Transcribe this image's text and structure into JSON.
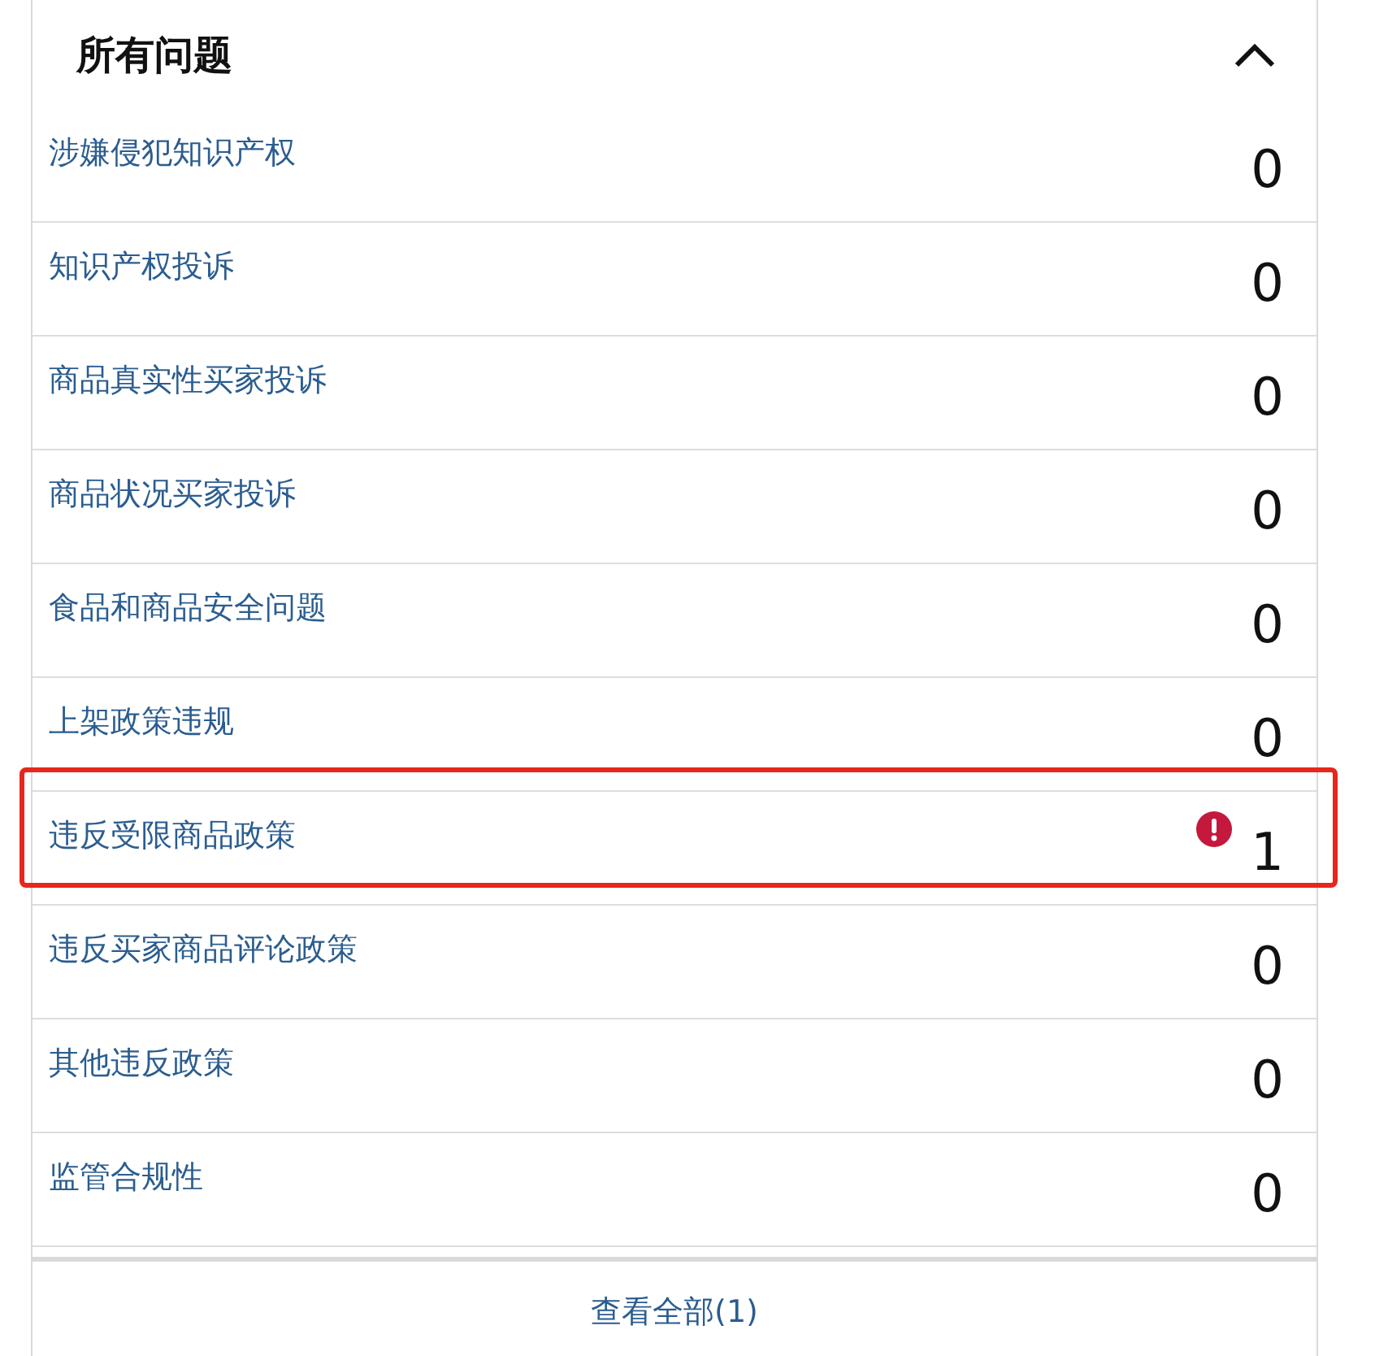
{
  "panel": {
    "title": "所有问题",
    "expanded": true
  },
  "rows": [
    {
      "label": "涉嫌侵犯知识产权",
      "count": "0",
      "alert": false,
      "highlighted": false
    },
    {
      "label": "知识产权投诉",
      "count": "0",
      "alert": false,
      "highlighted": false
    },
    {
      "label": "商品真实性买家投诉",
      "count": "0",
      "alert": false,
      "highlighted": false
    },
    {
      "label": "商品状况买家投诉",
      "count": "0",
      "alert": false,
      "highlighted": false
    },
    {
      "label": "食品和商品安全问题",
      "count": "0",
      "alert": false,
      "highlighted": false
    },
    {
      "label": "上架政策违规",
      "count": "0",
      "alert": false,
      "highlighted": false
    },
    {
      "label": "违反受限商品政策",
      "count": "1",
      "alert": true,
      "highlighted": true
    },
    {
      "label": "违反买家商品评论政策",
      "count": "0",
      "alert": false,
      "highlighted": false
    },
    {
      "label": "其他违反政策",
      "count": "0",
      "alert": false,
      "highlighted": false
    },
    {
      "label": "监管合规性",
      "count": "0",
      "alert": false,
      "highlighted": false
    }
  ],
  "footer": {
    "link": "查看全部(1)"
  }
}
